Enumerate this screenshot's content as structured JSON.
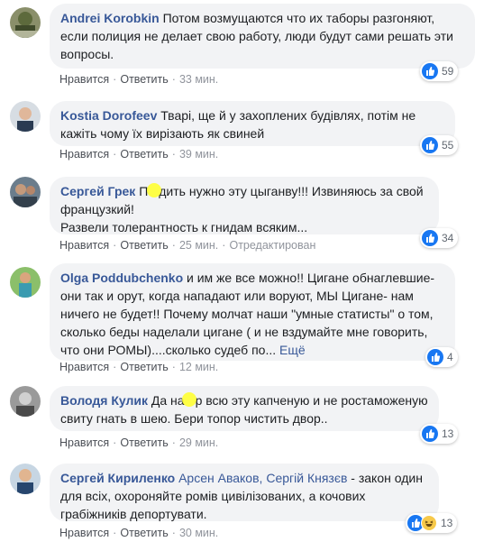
{
  "actions": {
    "like": "Нравится",
    "reply": "Ответить",
    "edited": "Отредактирован"
  },
  "colors": {
    "author": "#385898",
    "bubble": "#f2f3f5",
    "like": "#1877f2"
  },
  "comments": [
    {
      "author": "Andrei Korobkin",
      "text": "Потом возмущаются что их таборы разгоняют, если полиция не делает свою работу, люди будут сами решать эти вопросы.",
      "time": "33 мин.",
      "reactions": {
        "count": "59",
        "types": [
          "like-icon"
        ]
      }
    },
    {
      "author": "Kostia Dorofeev",
      "text": "Тварі, ще й у захоплених будівлях, потім не кажіть чому їх вирізають як свиней",
      "time": "39 мин.",
      "reactions": {
        "count": "55",
        "types": [
          "like-icon"
        ]
      }
    },
    {
      "author": "Сергей Грек",
      "text_a": "П",
      "text_b": "дить нужно эту цыганву!!! Извиняюсь за свой французкий!",
      "text_c": "Развели толерантность к гнидам всяким...",
      "time": "25 мин.",
      "reactions": {
        "count": "34",
        "types": [
          "like-icon"
        ]
      }
    },
    {
      "author": "Olga Poddubchenko",
      "text": "и им же все можно!! Цигане обнаглевшие- они так и орут, когда нападают или воруют, МЫ Цигане- нам ничего не будет!! Почему молчат наши \"умные статисты\" о том, сколько беды наделали цигане ( и не вздумайте мне говорить, что они РОМЫ)....сколько судеб по...",
      "more": "Ещё",
      "time": "12 мин.",
      "reactions": {
        "count": "4",
        "types": [
          "like-icon"
        ]
      }
    },
    {
      "author": "Володя Кулик",
      "text_a": "Да на",
      "text_b": "р всю эту капченую и не ростаможеную свиту гнать в шею. Бери топор чистить двор..",
      "time": "29 мин.",
      "reactions": {
        "count": "13",
        "types": [
          "like-icon"
        ]
      }
    },
    {
      "author": "Сергей Кириленко",
      "mention_1": "Арсен Аваков",
      "mention_sep": ", ",
      "mention_2": "Сергій Князєв",
      "text": " - закон один для всіх, охороняйте ромів цивілізованих, а кочових грабіжників депортувати.",
      "time": "30 мин.",
      "reactions": {
        "count": "13",
        "types": [
          "like-icon",
          "haha-icon"
        ]
      }
    }
  ]
}
